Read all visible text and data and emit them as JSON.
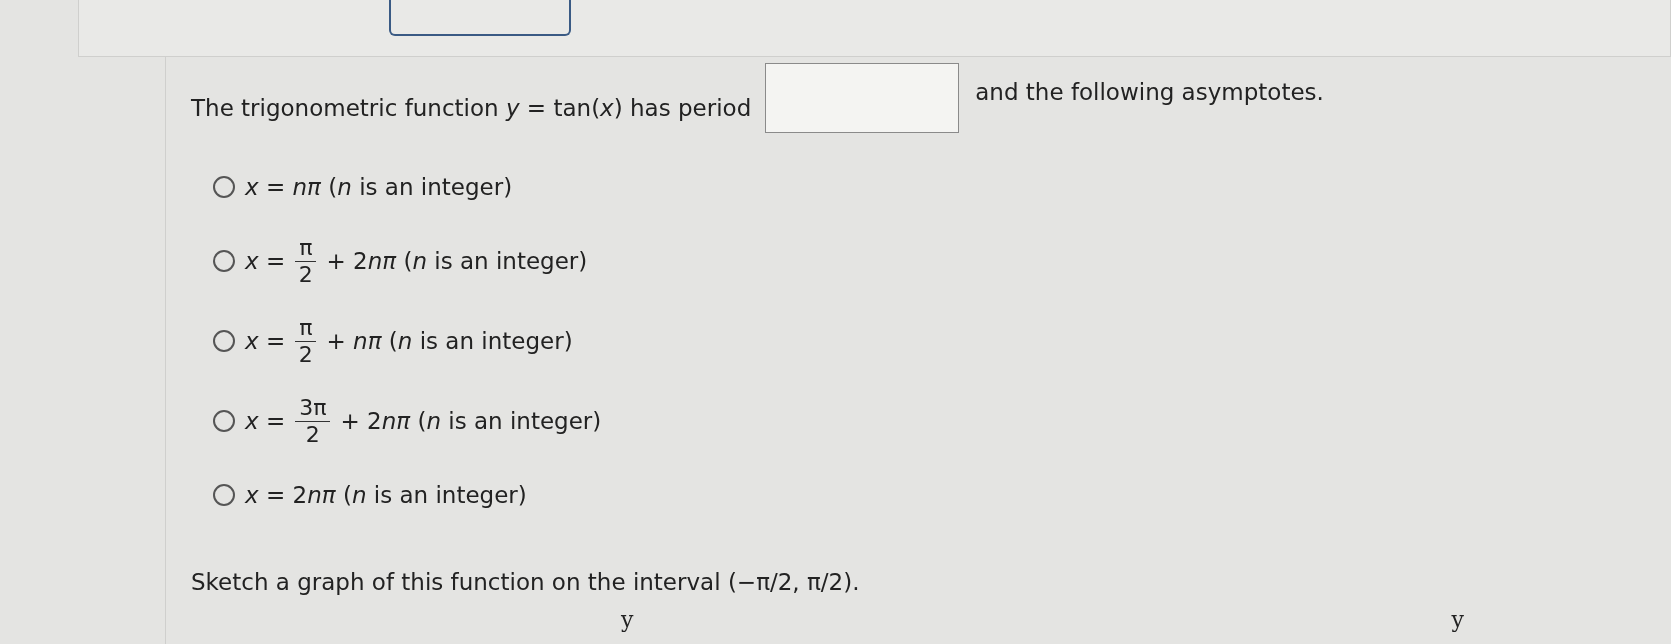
{
  "question": {
    "before": "The trigonometric function *y* = tan(*x*) has period",
    "after": "and the following asymptotes."
  },
  "options": [
    {
      "kind": "plain",
      "selected": false,
      "lhs": "*x* =",
      "rest": "*nπ* (*n* is an integer)"
    },
    {
      "kind": "fraction",
      "selected": false,
      "lhs": "*x* =",
      "numerator": "π",
      "denominator": "2",
      "coef": "+ 2",
      "rest": "*nπ* (*n* is an integer)"
    },
    {
      "kind": "fraction",
      "selected": false,
      "lhs": "*x* =",
      "numerator": "π",
      "denominator": "2",
      "coef": "+",
      "rest": " *nπ* (*n* is an integer)"
    },
    {
      "kind": "fraction",
      "selected": false,
      "lhs": "*x* =",
      "numerator": "3π",
      "denominator": "2",
      "coef": "+ 2",
      "rest": "*nπ* (*n* is an integer)"
    },
    {
      "kind": "plain",
      "selected": false,
      "lhs": "*x* =",
      "coef": "2",
      "rest": "*nπ* (*n* is an integer)"
    }
  ],
  "sketch_prompt": "Sketch a graph of this function on the interval (−π/2, π/2).",
  "graph_axis_labels": [
    "y",
    "y"
  ]
}
